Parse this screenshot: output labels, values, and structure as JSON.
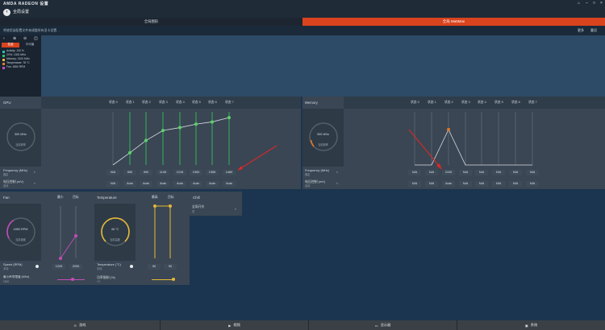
{
  "titlebar": {
    "brand": "AMDA RADEON 设置"
  },
  "header": {
    "title": "全局设置"
  },
  "tabs": [
    {
      "label": "全局图形"
    },
    {
      "label": "全局 WattMan"
    }
  ],
  "subbar": {
    "warning": "将使用该配置文件来调整所有显卡设置…",
    "right_a": "更多",
    "right_b": "重设"
  },
  "sidebar": {
    "tab_a": "性能",
    "tab_b": "平均值",
    "legend": [
      {
        "label": "Activity: 100 %",
        "color": "#22c3b0"
      },
      {
        "label": "GPU: 1300 MHz",
        "color": "#26c66d"
      },
      {
        "label": "Memory: 2100 MHz",
        "color": "#e5b838"
      },
      {
        "label": "Temperature: 78 °C",
        "color": "#e07a2a"
      },
      {
        "label": "Fan: 1850 RPM",
        "color": "#c64bb9"
      }
    ]
  },
  "gpu": {
    "title": "GPU",
    "gauge_value": "300 MHz",
    "gauge_label": "当前频率",
    "states": [
      "状态 0",
      "状态 1",
      "状态 2",
      "状态 3",
      "状态 4",
      "状态 5",
      "状态 6",
      "状态 7"
    ],
    "freq_label": "Frequency (MHz)",
    "freq_sub": "固定",
    "freq_values": [
      "N/A",
      "600",
      "900",
      "1145",
      "1215",
      "1300",
      "1355",
      "1460"
    ],
    "volt_label": "电压控制 (mV)",
    "volt_sub": "自动",
    "volt_values": [
      "N/A",
      "Auto",
      "Auto",
      "Auto",
      "Auto",
      "Auto",
      "Auto",
      "Auto"
    ]
  },
  "memory": {
    "title": "Memory",
    "gauge_value": "300 MHz",
    "gauge_label": "当前频率",
    "states": [
      "状态 0",
      "状态 1",
      "状态 2",
      "状态 3",
      "状态 4",
      "状态 5",
      "状态 6",
      "状态 7"
    ],
    "freq_label": "Frequency (MHz)",
    "freq_sub": "固定",
    "freq_values": [
      "N/A",
      "N/A",
      "2100",
      "N/A",
      "N/A",
      "N/A",
      "N/A",
      "N/A"
    ],
    "volt_label": "电压控制 (mV)",
    "volt_sub": "自动",
    "volt_values": [
      "N/A",
      "N/A",
      "Auto",
      "N/A",
      "N/A",
      "N/A",
      "N/A",
      "N/A"
    ]
  },
  "fan": {
    "title": "Fan",
    "col_a": "最小",
    "col_b": "目标",
    "gauge_value": "1850 RPM",
    "gauge_label": "当前速度",
    "speed_label": "Speed (RPM)",
    "speed_sub": "手动",
    "min_value": "1225",
    "target_value": "2200",
    "accel_label": "最小声学限值 (MHz)",
    "accel_sub": "1000"
  },
  "temperature": {
    "title": "Temperature",
    "col_a": "最高",
    "col_b": "目标",
    "gauge_value": "46 °C",
    "gauge_label": "当前温度",
    "temp_label": "Temperature (°C)",
    "temp_sub": "手动",
    "max_value": "90",
    "target_value": "90",
    "power_label": "功率限制 (%)",
    "power_sub": "+0"
  },
  "chill": {
    "title": "Chill",
    "toggle_label": "全局开关",
    "toggle_sub": "关"
  },
  "bottombar": {
    "games": "游戏",
    "video": "视频",
    "display": "显示器",
    "system": "系统"
  }
}
